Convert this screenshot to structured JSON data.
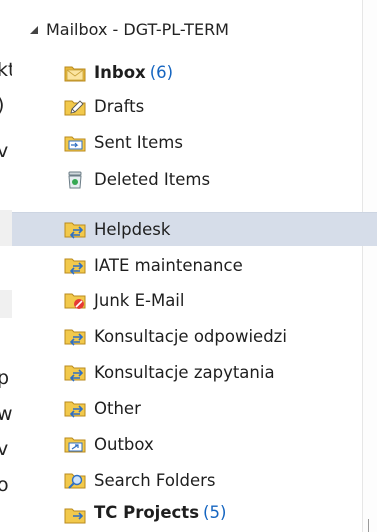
{
  "background_fragments": [
    "kt",
    ")",
    "v",
    "p",
    "w",
    "v",
    "o"
  ],
  "mailbox": {
    "title": "Mailbox - DGT-PL-TERM"
  },
  "folders": [
    {
      "name": "Inbox",
      "count": "(6)",
      "bold": true,
      "icon": "inbox-folder-icon"
    },
    {
      "name": "Drafts",
      "count": "",
      "bold": false,
      "icon": "drafts-folder-icon"
    },
    {
      "name": "Sent Items",
      "count": "",
      "bold": false,
      "icon": "sent-items-folder-icon"
    },
    {
      "name": "Deleted Items",
      "count": "",
      "bold": false,
      "icon": "deleted-items-icon"
    },
    {
      "name": "Helpdesk",
      "count": "",
      "bold": false,
      "selected": true,
      "icon": "shared-folder-icon"
    },
    {
      "name": "IATE maintenance",
      "count": "",
      "bold": false,
      "icon": "shared-folder-icon"
    },
    {
      "name": "Junk E-Mail",
      "count": "",
      "bold": false,
      "icon": "junk-folder-icon"
    },
    {
      "name": "Konsultacje odpowiedzi",
      "count": "",
      "bold": false,
      "icon": "shared-folder-icon"
    },
    {
      "name": "Konsultacje zapytania",
      "count": "",
      "bold": false,
      "icon": "shared-folder-icon"
    },
    {
      "name": "Other",
      "count": "",
      "bold": false,
      "icon": "shared-folder-icon"
    },
    {
      "name": "Outbox",
      "count": "",
      "bold": false,
      "icon": "outbox-folder-icon"
    },
    {
      "name": "Search Folders",
      "count": "",
      "bold": false,
      "icon": "search-folders-icon"
    },
    {
      "name": "TC Projects",
      "count": "(5)",
      "bold": true,
      "icon": "shared-folder-icon"
    }
  ],
  "colors": {
    "selected_bg": "#d6dde9",
    "count_blue": "#1565c0",
    "folder_yellow": "#f2c94c",
    "share_blue": "#2f6fc4"
  }
}
